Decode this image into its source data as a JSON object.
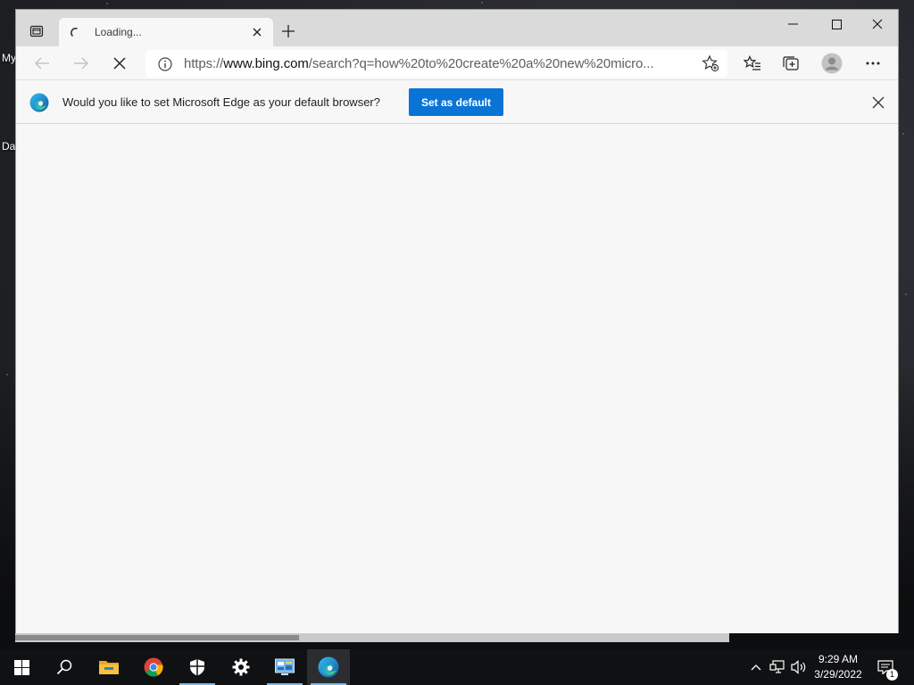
{
  "desktop": {
    "icon_labels": [
      "My",
      "Da"
    ]
  },
  "browser": {
    "tab": {
      "title": "Loading..."
    },
    "address_bar": {
      "url_scheme": "https://",
      "url_host": "www.bing.com",
      "url_rest": "/search?q=how%20to%20create%20a%20new%20micro..."
    },
    "infobar": {
      "message": "Would you like to set Microsoft Edge as your default browser?",
      "button_label": "Set as default"
    },
    "colors": {
      "accent": "#0a74d6"
    }
  },
  "taskbar": {
    "apps": [
      "start-icon",
      "search-icon",
      "file-explorer-icon",
      "chrome-icon",
      "windows-security-icon",
      "settings-icon",
      "control-panel-icon",
      "edge-icon"
    ],
    "clock": {
      "time": "9:29 AM",
      "date": "3/29/2022"
    },
    "notification_count": "1"
  }
}
